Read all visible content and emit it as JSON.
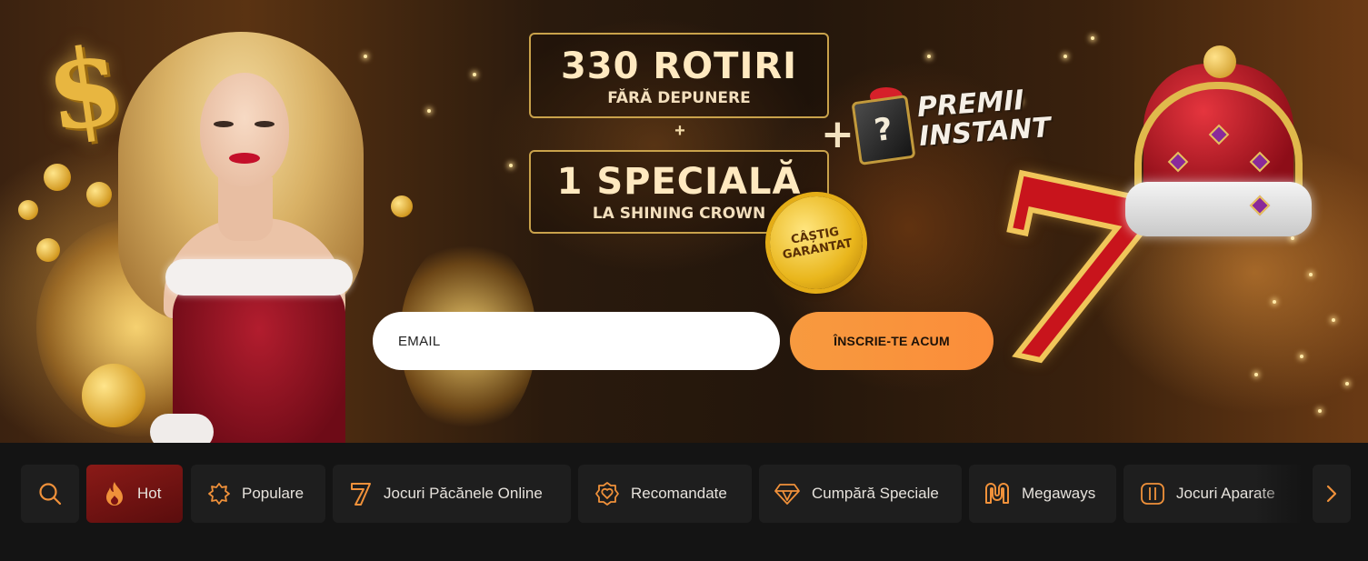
{
  "banner": {
    "offer_main": "330 ROTIRI",
    "offer_main_sub": "FĂRĂ DEPUNERE",
    "plus_small": "+",
    "offer_second": "1 SPECIALĂ",
    "offer_second_sub": "LA SHINING CROWN",
    "seal_line1": "CÂȘTIG",
    "seal_line2": "GARANTAT",
    "plus_big": "+",
    "gift_mark": "?",
    "premii_line1": "PREMII",
    "premii_line2": "INSTANT",
    "dollar_mark": "$",
    "seven_mark": "7"
  },
  "signup": {
    "email_placeholder": "EMAIL",
    "cta_label": "ÎNSCRIE-TE ACUM"
  },
  "nav": {
    "items": [
      {
        "label": "Hot",
        "icon": "flame-icon",
        "active": true
      },
      {
        "label": "Populare",
        "icon": "sparkle-badge-icon"
      },
      {
        "label": "Jocuri Păcănele Online",
        "icon": "seven-icon"
      },
      {
        "label": "Recomandate",
        "icon": "heart-badge-icon"
      },
      {
        "label": "Cumpără Speciale",
        "icon": "diamond-icon"
      },
      {
        "label": "Megaways",
        "icon": "megaways-icon"
      },
      {
        "label": "Jocuri Aparate",
        "icon": "slot-machine-icon"
      }
    ]
  },
  "colors": {
    "accent": "#f0913a",
    "nav_bg": "#1e1e1e",
    "active_bg": "#8a1a17",
    "page_bg": "#141414"
  }
}
